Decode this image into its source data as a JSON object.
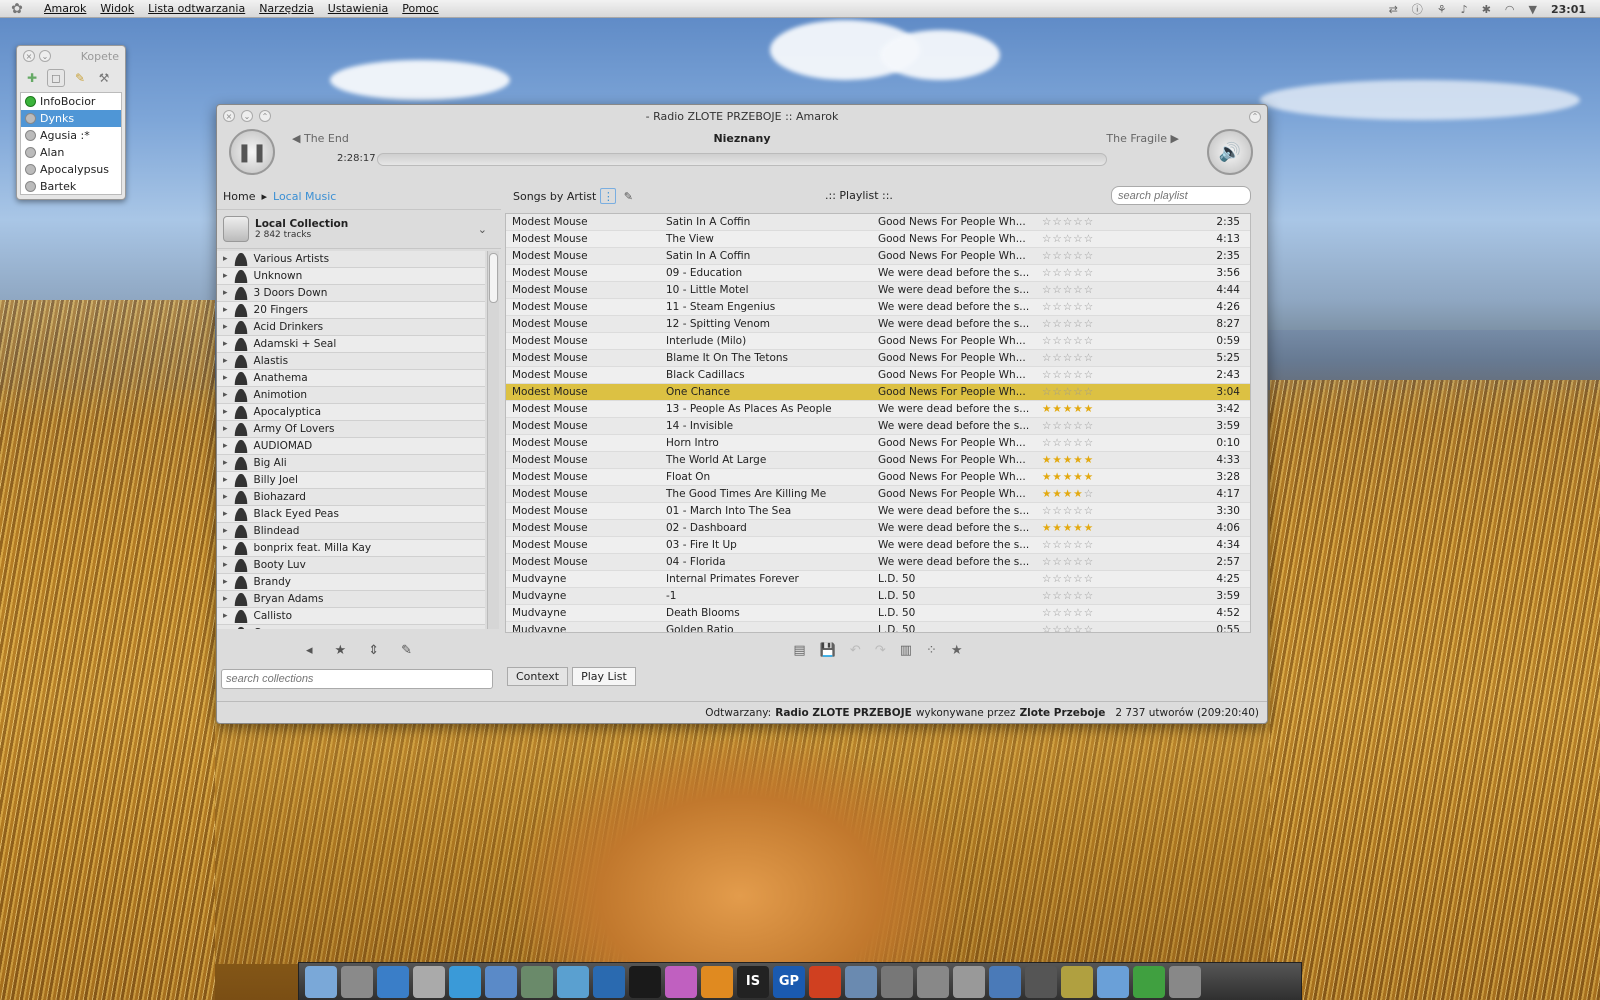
{
  "topbar": {
    "menus": [
      "Amarok",
      "Widok",
      "Lista odtwarzania",
      "Narzędzia",
      "Ustawienia",
      "Pomoc"
    ],
    "clock": "23:01"
  },
  "kopete": {
    "title": "Kopete",
    "contacts": [
      {
        "name": "InfoBocior",
        "online": true,
        "selected": false
      },
      {
        "name": "Dynks",
        "online": false,
        "selected": true
      },
      {
        "name": "Agusia :*",
        "online": false,
        "selected": false
      },
      {
        "name": "Alan",
        "online": false,
        "selected": false
      },
      {
        "name": "Apocalypsus",
        "online": false,
        "selected": false
      },
      {
        "name": "Bartek",
        "online": false,
        "selected": false
      }
    ]
  },
  "amarok": {
    "window_title": "- Radio ZLOTE PRZEBOJE  ::  Amarok",
    "prev_track": "The End",
    "now_playing": "Nieznany",
    "next_track": "The Fragile",
    "elapsed": "2:28:17",
    "breadcrumb": {
      "home": "Home",
      "current": "Local Music"
    },
    "collection": {
      "name": "Local Collection",
      "count": "2 842 tracks"
    },
    "artists": [
      "Various Artists",
      "Unknown",
      "3 Doors Down",
      "20 Fingers",
      "Acid Drinkers",
      "Adamski + Seal",
      "Alastis",
      "Anathema",
      "Animotion",
      "Apocalyptica",
      "Army Of Lovers",
      "AUDIOMAD",
      "Big Ali",
      "Billy Joel",
      "Biohazard",
      "Black Eyed Peas",
      "Blindead",
      "bonprix feat. Milla Kay",
      "Booty Luv",
      "Brandy",
      "Bryan Adams",
      "Callisto",
      "Carcass"
    ],
    "search_collections_placeholder": "search collections",
    "playlist_sort": "Songs by Artist",
    "playlist_title": ".:: Playlist ::.",
    "search_playlist_placeholder": "search playlist",
    "tracks": [
      {
        "artist": "Modest Mouse",
        "title": "Satin In A Coffin",
        "album": "Good News For People Wh...",
        "rating": 0,
        "length": "2:35",
        "playing": false
      },
      {
        "artist": "Modest Mouse",
        "title": "The View",
        "album": "Good News For People Wh...",
        "rating": 0,
        "length": "4:13",
        "playing": false
      },
      {
        "artist": "Modest Mouse",
        "title": "Satin In A Coffin",
        "album": "Good News For People Wh...",
        "rating": 0,
        "length": "2:35",
        "playing": false
      },
      {
        "artist": "Modest Mouse",
        "title": "09 - Education",
        "album": "We were dead before the s...",
        "rating": 0,
        "length": "3:56",
        "playing": false
      },
      {
        "artist": "Modest Mouse",
        "title": "10 - Little Motel",
        "album": "We were dead before the s...",
        "rating": 0,
        "length": "4:44",
        "playing": false
      },
      {
        "artist": "Modest Mouse",
        "title": "11 - Steam Engenius",
        "album": "We were dead before the s...",
        "rating": 0,
        "length": "4:26",
        "playing": false
      },
      {
        "artist": "Modest Mouse",
        "title": "12 - Spitting Venom",
        "album": "We were dead before the s...",
        "rating": 0,
        "length": "8:27",
        "playing": false
      },
      {
        "artist": "Modest Mouse",
        "title": "Interlude (Milo)",
        "album": "Good News For People Wh...",
        "rating": 0,
        "length": "0:59",
        "playing": false
      },
      {
        "artist": "Modest Mouse",
        "title": "Blame It On The Tetons",
        "album": "Good News For People Wh...",
        "rating": 0,
        "length": "5:25",
        "playing": false
      },
      {
        "artist": "Modest Mouse",
        "title": "Black Cadillacs",
        "album": "Good News For People Wh...",
        "rating": 0,
        "length": "2:43",
        "playing": false
      },
      {
        "artist": "Modest Mouse",
        "title": "One Chance",
        "album": "Good News For People Wh...",
        "rating": 0,
        "length": "3:04",
        "playing": true
      },
      {
        "artist": "Modest Mouse",
        "title": "13 - People As Places As People",
        "album": "We were dead before the s...",
        "rating": 5,
        "length": "3:42",
        "playing": false
      },
      {
        "artist": "Modest Mouse",
        "title": "14 - Invisible",
        "album": "We were dead before the s...",
        "rating": 0,
        "length": "3:59",
        "playing": false
      },
      {
        "artist": "Modest Mouse",
        "title": "Horn Intro",
        "album": "Good News For People Wh...",
        "rating": 0,
        "length": "0:10",
        "playing": false
      },
      {
        "artist": "Modest Mouse",
        "title": "The World At Large",
        "album": "Good News For People Wh...",
        "rating": 4.5,
        "length": "4:33",
        "playing": false
      },
      {
        "artist": "Modest Mouse",
        "title": "Float On",
        "album": "Good News For People Wh...",
        "rating": 5,
        "length": "3:28",
        "playing": false
      },
      {
        "artist": "Modest Mouse",
        "title": "The Good Times Are Killing Me",
        "album": "Good News For People Wh...",
        "rating": 3.5,
        "length": "4:17",
        "playing": false
      },
      {
        "artist": "Modest Mouse",
        "title": "01 - March Into The Sea",
        "album": "We were dead before the s...",
        "rating": 0,
        "length": "3:30",
        "playing": false
      },
      {
        "artist": "Modest Mouse",
        "title": "02 - Dashboard",
        "album": "We were dead before the s...",
        "rating": 4.5,
        "length": "4:06",
        "playing": false
      },
      {
        "artist": "Modest Mouse",
        "title": "03 - Fire It Up",
        "album": "We were dead before the s...",
        "rating": 0,
        "length": "4:34",
        "playing": false
      },
      {
        "artist": "Modest Mouse",
        "title": "04 - Florida",
        "album": "We were dead before the s...",
        "rating": 0,
        "length": "2:57",
        "playing": false
      },
      {
        "artist": "Mudvayne",
        "title": "Internal Primates Forever",
        "album": "L.D. 50",
        "rating": 0,
        "length": "4:25",
        "playing": false
      },
      {
        "artist": "Mudvayne",
        "title": "-1",
        "album": "L.D. 50",
        "rating": 0,
        "length": "3:59",
        "playing": false
      },
      {
        "artist": "Mudvayne",
        "title": "Death Blooms",
        "album": "L.D. 50",
        "rating": 0,
        "length": "4:52",
        "playing": false
      },
      {
        "artist": "Mudvayne",
        "title": "Golden Ratio",
        "album": "L.D. 50",
        "rating": 0,
        "length": "0:55",
        "playing": false
      }
    ],
    "tabs": [
      "Context",
      "Play List"
    ],
    "status": {
      "prefix": "Odtwarzany:",
      "station": "Radio ZLOTE PRZEBOJE",
      "by": "wykonywane przez",
      "artist": "Zlote Przeboje",
      "summary": "2 737 utworów (209:20:40)"
    }
  },
  "dock": {
    "icons": [
      "folder-icon",
      "files-icon",
      "browser-icon",
      "mail-icon",
      "chat-icon",
      "email-icon",
      "calendar-icon",
      "paint-icon",
      "bird-icon",
      "media-icon",
      "eye-icon",
      "play-icon",
      "text-icon",
      "gp-icon",
      "flame-icon",
      "tool-icon",
      "scissors-icon",
      "grid-icon",
      "blank-icon",
      "globe-icon",
      "bubble-icon",
      "user-icon",
      "window-icon",
      "download-icon",
      "trash-icon"
    ],
    "labels": {
      "text-icon": "IS",
      "gp-icon": "GP"
    }
  }
}
